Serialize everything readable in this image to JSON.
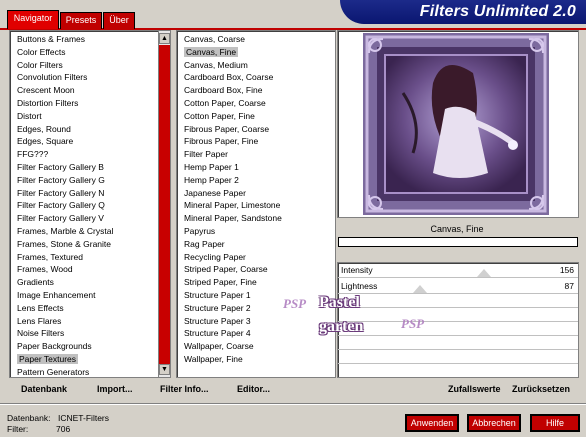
{
  "app": {
    "title": "Filters Unlimited 2.0"
  },
  "tabs": [
    {
      "label": "Navigator",
      "active": true
    },
    {
      "label": "Presets",
      "active": false
    },
    {
      "label": "Über",
      "active": false
    }
  ],
  "categories": [
    "Buttons & Frames",
    "Color Effects",
    "Color Filters",
    "Convolution Filters",
    "Crescent Moon",
    "Distortion Filters",
    "Distort",
    "Edges, Round",
    "Edges, Square",
    "FFG???",
    "Filter Factory Gallery B",
    "Filter Factory Gallery G",
    "Filter Factory Gallery N",
    "Filter Factory Gallery Q",
    "Filter Factory Gallery V",
    "Frames, Marble & Crystal",
    "Frames, Stone & Granite",
    "Frames, Textured",
    "Frames, Wood",
    "Gradients",
    "Image Enhancement",
    "Lens Effects",
    "Lens Flares",
    "Noise Filters",
    "Paper Backgrounds",
    "Paper Textures",
    "Pattern Generators"
  ],
  "selected_category": "Paper Textures",
  "filters": [
    "Canvas, Coarse",
    "Canvas, Fine",
    "Canvas, Medium",
    "Cardboard Box, Coarse",
    "Cardboard Box, Fine",
    "Cotton Paper, Coarse",
    "Cotton Paper, Fine",
    "Fibrous Paper, Coarse",
    "Fibrous Paper, Fine",
    "Filter Paper",
    "Hemp Paper 1",
    "Hemp Paper 2",
    "Japanese Paper",
    "Mineral Paper, Limestone",
    "Mineral Paper, Sandstone",
    "Papyrus",
    "Rag Paper",
    "Recycling Paper",
    "Striped Paper, Coarse",
    "Striped Paper, Fine",
    "Structure Paper 1",
    "Structure Paper 2",
    "Structure Paper 3",
    "Structure Paper 4",
    "Wallpaper, Coarse",
    "Wallpaper, Fine"
  ],
  "selected_filter": "Canvas, Fine",
  "preview_label": "Canvas, Fine",
  "sliders": [
    {
      "label": "Intensity",
      "value": "156",
      "level": 0.61
    },
    {
      "label": "Lightness",
      "value": "87",
      "level": 0.34
    }
  ],
  "watermark": {
    "line1": "Pastel",
    "line2": "garten",
    "mark": "PSP"
  },
  "bottom_left": {
    "datenbank": "Datenbank",
    "import": "Import...",
    "filter_info": "Filter Info...",
    "editor": "Editor..."
  },
  "bottom_right": {
    "zufallswerte": "Zufallswerte",
    "zuruecksetzen": "Zurücksetzen"
  },
  "status": {
    "db_label": "Datenbank:",
    "db_value": "ICNET-Filters",
    "filter_label": "Filter:",
    "filter_value": "706"
  },
  "buttons": {
    "apply": "Anwenden",
    "cancel": "Abbrechen",
    "help": "Hilfe"
  },
  "colors": {
    "accent": "#c00000",
    "banner": "#0a1670",
    "frame": "#6a4f8a"
  }
}
